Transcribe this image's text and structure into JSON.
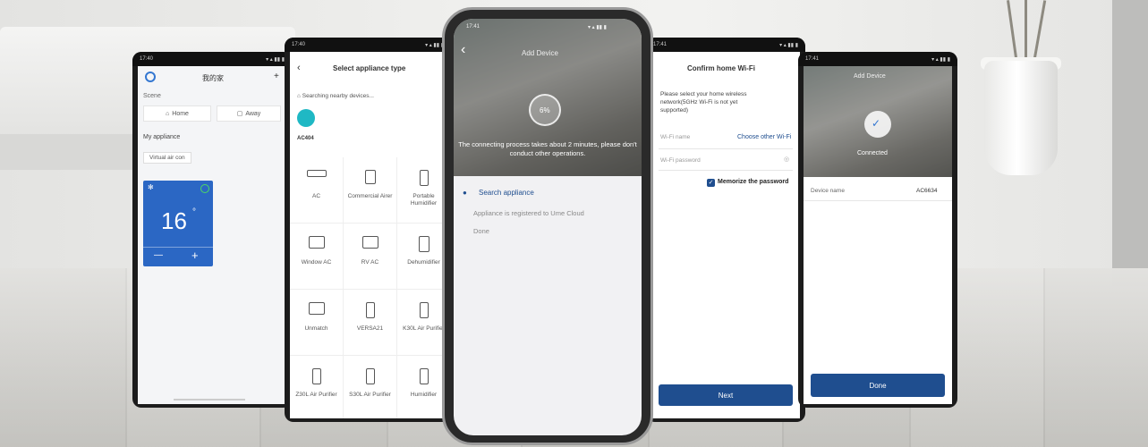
{
  "accent": "#1f4e8f",
  "ac_tile_color": "#2b67c4",
  "phone1": {
    "title": "我的家",
    "scene_label": "Scene",
    "scene_home": "Home",
    "scene_away": "Away",
    "my_appliance_label": "My appliance",
    "device_name": "Virtual air con",
    "temperature": "16",
    "temp_unit": "°",
    "minus": "—",
    "plus": "+"
  },
  "phone2": {
    "title": "Select appliance type",
    "searching": "Searching nearby devices...",
    "found_device": "AC404",
    "appliances": [
      {
        "label": "AC",
        "icon": "ac-icon"
      },
      {
        "label": "Commercial Airer",
        "icon": "commercial-icon"
      },
      {
        "label": "Portable Humidifier",
        "icon": "portable-icon"
      },
      {
        "label": "Window AC",
        "icon": "window-ac-icon"
      },
      {
        "label": "RV AC",
        "icon": "rv-ac-icon"
      },
      {
        "label": "Dehumidifier",
        "icon": "dehumidifier-icon"
      },
      {
        "label": "Unmatch",
        "icon": "unmatch-icon"
      },
      {
        "label": "VERSA21",
        "icon": "versa-icon"
      },
      {
        "label": "K30L Air Purifier",
        "icon": "purifier-icon"
      },
      {
        "label": "Z30L Air Purifier",
        "icon": "purifier-icon"
      },
      {
        "label": "S30L Air Purifier",
        "icon": "purifier-icon"
      },
      {
        "label": "Humidifier",
        "icon": "humidifier-icon"
      }
    ]
  },
  "phone3": {
    "title": "Add Device",
    "progress_text": "6%",
    "progress": 0.06,
    "notice": "The connecting process takes about 2 minutes, please don't conduct other operations.",
    "steps": [
      "Search appliance",
      "Appliance is registered to Ume Cloud",
      "Done"
    ]
  },
  "phone4": {
    "title": "Confirm home Wi-Fi",
    "description": "Please select your home wireless network(5GHz Wi-Fi is not yet supported)",
    "wifi_name_label": "Wi-Fi name",
    "choose_other": "Choose other Wi-Fi",
    "wifi_password_label": "Wi-Fi password",
    "memorize": "Memorize the password",
    "next_button": "Next"
  },
  "phone5": {
    "title": "Add Device",
    "status": "Connected",
    "device_name_label": "Device name",
    "device_name_value": "AC6634",
    "done_button": "Done"
  }
}
